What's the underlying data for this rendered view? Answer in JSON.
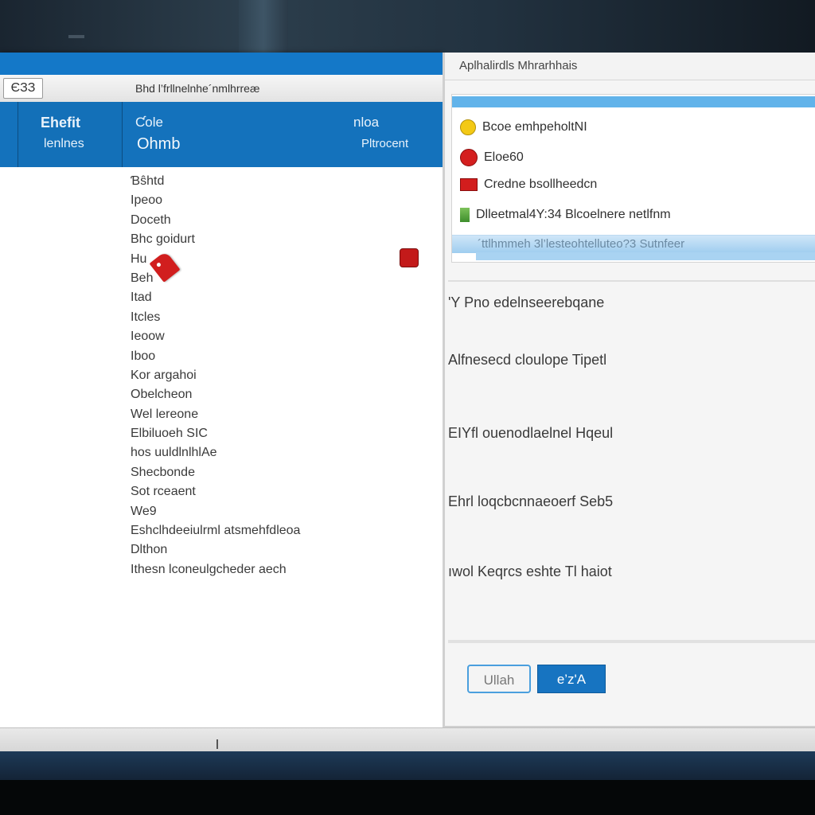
{
  "left_window": {
    "toolbar_icon_text": "ЄЗЗ",
    "toolbar_title": "Bhd l’frllnelnhe´nmlhrreæ",
    "header": {
      "left_line1": "Ehefit",
      "left_line2": "lenlnes",
      "mid_line1": "Ƈole",
      "mid_line2": "Ohmb",
      "right_line1": "nloa",
      "right_line2": "Pltrocent"
    },
    "list_items": [
      "Ɓŝhtd",
      "Ipeoo",
      "Doceth",
      "Bhc goidurt",
      "Hu",
      "Beh",
      "Itad",
      "Itcles",
      "Ieoow",
      "Iboo",
      "Kor argahoi",
      "Obelcheon",
      "Wel lereone",
      "Elbiluoeh SIC",
      "hos  uuldlnlhlAe",
      "Shecbonde",
      "Sot rceaent",
      "We9",
      "Eshclhdeeiulrml atsmehfdleoa",
      "Dlthon",
      "Ithesn lconeulgcheder aech"
    ]
  },
  "right_window": {
    "title": "Aplhalirdls Mhrarhhais",
    "panel_items": [
      {
        "icon": "yellow-dot-icon",
        "label": "Bcoe emhpeholtNI"
      },
      {
        "icon": "red-circle-icon",
        "label": "Eloe60"
      },
      {
        "icon": "red-square-icon",
        "label": "Credne  bsollheedcn"
      },
      {
        "icon": "green-bar-icon",
        "label": "Dlleetmal4Y:34 Blcoelnere netlfnm"
      }
    ],
    "selected_row_text": "´ttlhmmeh 3l’lesteohtelluteo?3  Sutnfeer",
    "descriptions": [
      "'Y Pno edelnseerebqane",
      "Alfnesecd cloulope Tipetl",
      "EIYfl ouenodlaelnel Hqeul",
      "Ehrl loqcbcnnaeoerf Seb5",
      "ıwol Keqrcs eshte  Tl haiot"
    ],
    "buttons": {
      "secondary": "Ullah",
      "primary": "e’z'A"
    }
  },
  "colors": {
    "accent": "#1472bc",
    "selection": "#61b3ea",
    "alert_red": "#d11e1e",
    "warning_yellow": "#f3c915"
  }
}
